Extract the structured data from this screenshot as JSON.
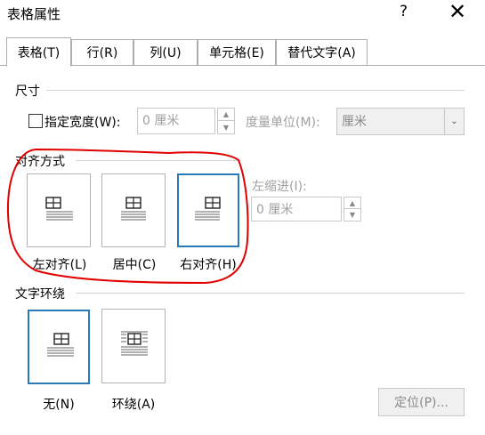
{
  "window": {
    "title": "表格属性",
    "help_label": "?",
    "close_label": "✕"
  },
  "tabs": [
    {
      "label": "表格(T)",
      "active": true
    },
    {
      "label": "行(R)",
      "active": false
    },
    {
      "label": "列(U)",
      "active": false
    },
    {
      "label": "单元格(E)",
      "active": false
    },
    {
      "label": "替代文字(A)",
      "active": false
    }
  ],
  "size": {
    "group_label": "尺寸",
    "preferred_width_label": "指定宽度(W):",
    "preferred_width_checked": false,
    "width_value": "0 厘米",
    "measure_label": "度量单位(M):",
    "measure_value": "厘米"
  },
  "alignment": {
    "group_label": "对齐方式",
    "options": [
      {
        "label": "左对齐(L)",
        "selected": false
      },
      {
        "label": "居中(C)",
        "selected": false
      },
      {
        "label": "右对齐(H)",
        "selected": true
      }
    ],
    "indent_label": "左缩进(I):",
    "indent_value": "0 厘米",
    "annotation_color": "#e00000"
  },
  "wrapping": {
    "group_label": "文字环绕",
    "options": [
      {
        "label": "无(N)",
        "selected": true
      },
      {
        "label": "环绕(A)",
        "selected": false
      }
    ],
    "position_button": "定位(P)..."
  },
  "colors": {
    "accent": "#2a7ab8",
    "disabled_text": "#a0a0a0"
  }
}
